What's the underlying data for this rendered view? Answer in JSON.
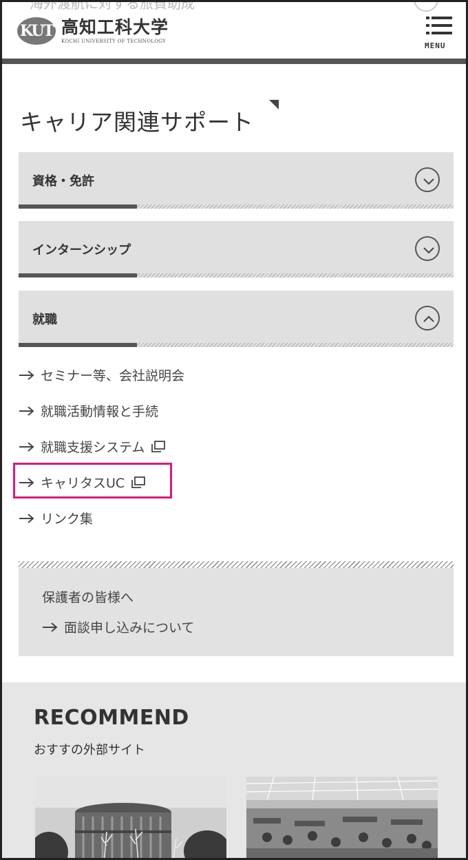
{
  "header": {
    "ghost_text": "海外渡航に対する旅費助成",
    "logo_mark": "KUT",
    "logo_jp": "高知工科大学",
    "logo_en": "KOCHI UNIVERSITY OF TECHNOLOGY",
    "menu_label": "MENU"
  },
  "section": {
    "title": "キャリア関連サポート",
    "accordions": [
      {
        "label": "資格・免許",
        "state": "collapsed"
      },
      {
        "label": "インターンシップ",
        "state": "collapsed"
      },
      {
        "label": "就職",
        "state": "expanded"
      }
    ],
    "links": [
      {
        "label": "セミナー等、会社説明会",
        "external": false
      },
      {
        "label": "就職活動情報と手続",
        "external": false
      },
      {
        "label": "就職支援システム",
        "external": true
      },
      {
        "label": "キャリタスUC",
        "external": true
      },
      {
        "label": "リンク集",
        "external": false
      }
    ]
  },
  "parents": {
    "title": "保護者の皆様へ",
    "link": "面談申し込みについて"
  },
  "recommend": {
    "title": "RECOMMEND",
    "subtitle": "おすすの外部サイト"
  },
  "colors": {
    "highlight": "#e0177a",
    "accordion_bg": "#e0e0e0",
    "accent_bar": "#555555"
  }
}
